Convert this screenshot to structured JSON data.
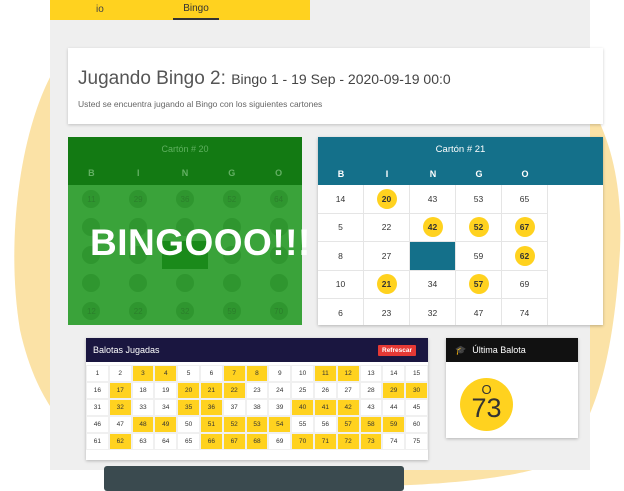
{
  "colors": {
    "accent": "#ffd21f",
    "card20": "#137a13",
    "card21": "#14708a",
    "balotas_header": "#1a1640",
    "refresh": "#e53935"
  },
  "nav": {
    "prev_tab": "io",
    "active_tab": "Bingo"
  },
  "header": {
    "title": "Jugando Bingo 2:",
    "subtitle": "Bingo 1 - 19 Sep - 2020-09-19 00:0",
    "description": "Usted se encuentra jugando al Bingo con los siguientes cartones"
  },
  "carton20": {
    "title": "Cartón # 20",
    "headers": [
      "B",
      "I",
      "N",
      "G",
      "O"
    ],
    "rows": [
      [
        "11",
        "29",
        "36",
        "52",
        "64"
      ],
      [
        "",
        "",
        "",
        "",
        ""
      ],
      [
        "",
        "",
        "",
        "",
        ""
      ],
      [
        "",
        "",
        "",
        "",
        ""
      ],
      [
        "12",
        "22",
        "32",
        "59",
        "70"
      ]
    ],
    "cells": [
      "11",
      "29",
      "36",
      "52",
      "64",
      "",
      "",
      "",
      "",
      "",
      "",
      "",
      "",
      "",
      "",
      "",
      "",
      "",
      "",
      "",
      "12",
      "22",
      "32",
      "59",
      "70"
    ],
    "status": "BINGOOO!!!"
  },
  "carton21": {
    "title": "Cartón # 21",
    "headers": [
      "B",
      "I",
      "N",
      "G",
      "O"
    ],
    "cells": [
      "14",
      "20",
      "43",
      "53",
      "65",
      "5",
      "22",
      "42",
      "52",
      "67",
      "8",
      "27",
      "",
      "59",
      "62",
      "10",
      "21",
      "34",
      "57",
      "69",
      "6",
      "23",
      "32",
      "47",
      "74"
    ],
    "marked": [
      "20",
      "42",
      "52",
      "67",
      "62",
      "21",
      "57"
    ]
  },
  "balotas": {
    "title": "Balotas Jugadas",
    "refresh_label": "Refrescar",
    "numbers": [
      "1",
      "2",
      "3",
      "4",
      "5",
      "6",
      "7",
      "8",
      "9",
      "10",
      "11",
      "12",
      "13",
      "14",
      "15",
      "16",
      "17",
      "18",
      "19",
      "20",
      "21",
      "22",
      "23",
      "24",
      "25",
      "26",
      "27",
      "28",
      "29",
      "30",
      "31",
      "32",
      "33",
      "34",
      "35",
      "36",
      "37",
      "38",
      "39",
      "40",
      "41",
      "42",
      "43",
      "44",
      "45",
      "46",
      "47",
      "48",
      "49",
      "50",
      "51",
      "52",
      "53",
      "54",
      "55",
      "56",
      "57",
      "58",
      "59",
      "60",
      "61",
      "62",
      "63",
      "64",
      "65",
      "66",
      "67",
      "68",
      "69",
      "70",
      "71",
      "72",
      "73",
      "74",
      "75"
    ],
    "played": [
      "3",
      "4",
      "7",
      "8",
      "11",
      "12",
      "17",
      "20",
      "21",
      "22",
      "29",
      "30",
      "32",
      "35",
      "36",
      "40",
      "41",
      "42",
      "48",
      "49",
      "51",
      "52",
      "53",
      "54",
      "57",
      "58",
      "59",
      "62",
      "66",
      "67",
      "68",
      "70",
      "71",
      "72",
      "73"
    ]
  },
  "ultima": {
    "title": "Última Balota",
    "letter": "O",
    "number": "73"
  }
}
